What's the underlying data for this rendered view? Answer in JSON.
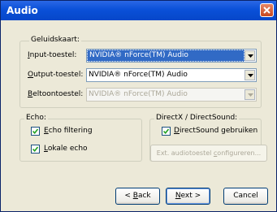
{
  "window": {
    "title": "Audio"
  },
  "soundcard": {
    "legend": "Geluidskaart:",
    "input_label": "Input-toestel:",
    "input_value": "NVIDIA® nForce(TM) Audio",
    "output_label": "Output-toestel:",
    "output_value": "NVIDIA® nForce(TM) Audio",
    "ring_label": "Beltoontoestel:",
    "ring_value": "NVIDIA® nForce(TM) Audio"
  },
  "echo": {
    "legend": "Echo:",
    "filtering_label": "Echo filtering",
    "filtering_checked": true,
    "local_label": "Lokale echo",
    "local_checked": true
  },
  "directx": {
    "legend": "DirectX / DirectSound:",
    "use_label": "DirectSound gebruiken",
    "use_checked": true,
    "configure_label": "Ext. audiotoestel configureren..."
  },
  "buttons": {
    "back": "< Back",
    "next": "Next >",
    "cancel": "Cancel"
  }
}
